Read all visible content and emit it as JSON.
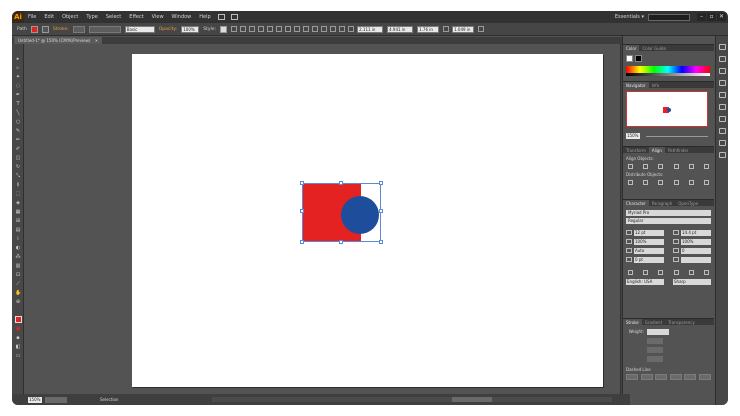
{
  "app": {
    "logo": "Ai",
    "workspace": "Essentials ▾"
  },
  "menu": [
    "File",
    "Edit",
    "Object",
    "Type",
    "Select",
    "Effect",
    "View",
    "Window",
    "Help"
  ],
  "window_buttons": [
    "–",
    "▫",
    "✕"
  ],
  "control_bar": {
    "path_label": "Path",
    "stroke_label": "Stroke:",
    "style_label": "Basic",
    "opacity_label": "Opacity:",
    "opacity_value": "100%",
    "style2_label": "Style:",
    "x_value": "2.111 in",
    "y_value": "4.941 in",
    "w_value": "1.76 in",
    "h_value": "1.049 in"
  },
  "document_tab": {
    "title": "Untitled-1* @ 150% (CMYK/Preview)",
    "close": "✕"
  },
  "panels": {
    "color_tabs": [
      "Color",
      "Color Guide"
    ],
    "navigator_tabs": [
      "Navigator",
      "Info"
    ],
    "navigator_zoom": "150%",
    "align_tabs": [
      "Transform",
      "Align",
      "Pathfinder"
    ],
    "align_objects_label": "Align Objects:",
    "distribute_objects_label": "Distribute Objects:",
    "character_tabs": [
      "Character",
      "Paragraph",
      "OpenType"
    ],
    "font_family": "Myriad Pro",
    "font_style": "Regular",
    "font_size": "12 pt",
    "leading": "14.4 pt",
    "tracking": "Auto",
    "kerning": "0",
    "scale_h": "100%",
    "scale_v": "100%",
    "baseline": "0 pt",
    "language": "English: USA",
    "sharp": "Sharp",
    "stroke_tabs": [
      "Stroke",
      "Gradient",
      "Transparency"
    ],
    "weight_label": "Weight:",
    "dashed_line_label": "Dashed Line"
  },
  "status": {
    "zoom": "150%",
    "tool": "Selection"
  },
  "colors": {
    "rect_fill": "#e42222",
    "circle_fill": "#1e4d9c",
    "selection": "#5b8ad6",
    "ui_bg": "#535353"
  }
}
